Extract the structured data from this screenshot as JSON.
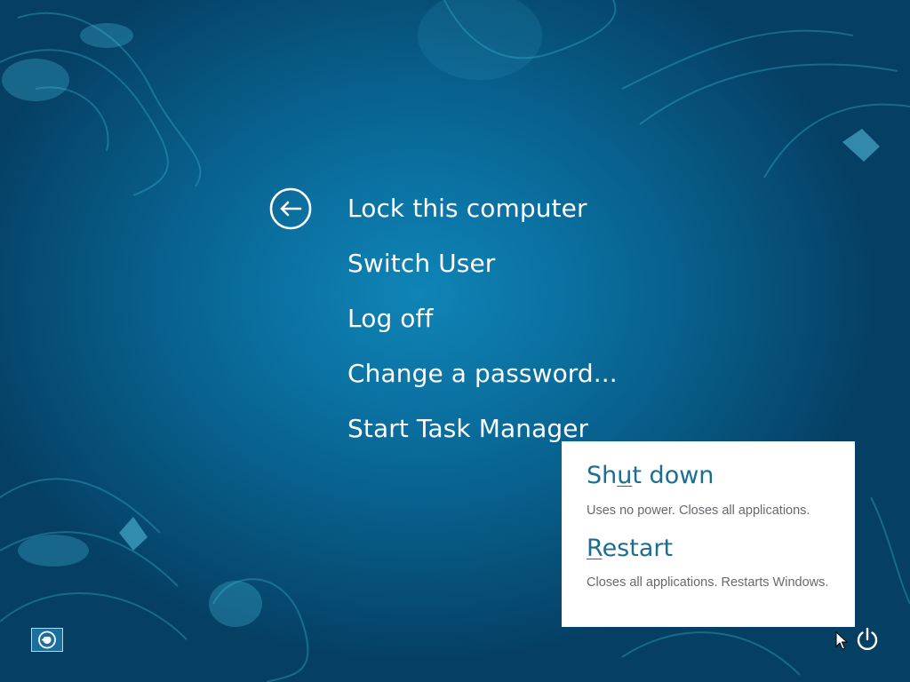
{
  "menu": {
    "back_icon": "back-arrow-icon",
    "items": [
      {
        "label": "Lock this computer"
      },
      {
        "label": "Switch User"
      },
      {
        "label": "Log off"
      },
      {
        "label": "Change a password..."
      },
      {
        "label": "Start Task Manager"
      }
    ]
  },
  "power_menu": {
    "shutdown": {
      "label_before": "Sh",
      "label_access_key": "u",
      "label_after": "t down",
      "description": "Uses no power. Closes all applications."
    },
    "restart": {
      "label_before": "",
      "label_access_key": "R",
      "label_after": "estart",
      "description": "Closes all applications. Restarts Windows."
    }
  },
  "bottom_bar": {
    "ease_of_access_icon": "ease-of-access-icon",
    "power_icon": "power-icon"
  },
  "colors": {
    "background": "#0a6f9f",
    "menu_text": "#ffffff",
    "popup_title": "#1b6d92",
    "popup_desc": "#666a6e"
  }
}
